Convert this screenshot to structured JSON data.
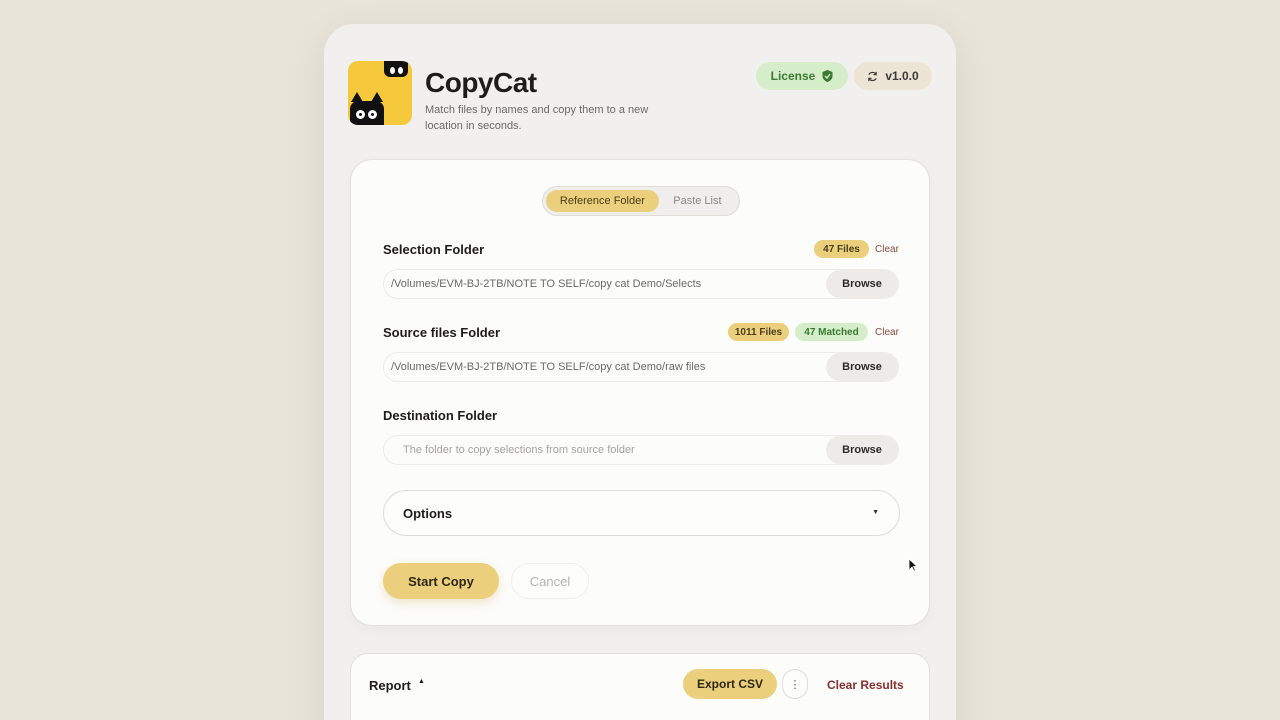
{
  "app": {
    "title": "CopyCat",
    "description": "Match files by names and copy them to a new location in seconds."
  },
  "header": {
    "license_label": "License",
    "version_label": "v1.0.0"
  },
  "mode_toggle": {
    "active": "Reference Folder",
    "inactive": "Paste List"
  },
  "selection": {
    "label": "Selection Folder",
    "files_badge": "47 Files",
    "clear_label": "Clear",
    "path": "/Volumes/EVM-BJ-2TB/NOTE TO SELF/copy cat Demo/Selects",
    "browse_label": "Browse"
  },
  "source": {
    "label": "Source files Folder",
    "files_badge": "1011 Files",
    "matched_badge": "47 Matched",
    "clear_label": "Clear",
    "path": "/Volumes/EVM-BJ-2TB/NOTE TO SELF/copy cat Demo/raw files",
    "browse_label": "Browse"
  },
  "destination": {
    "label": "Destination Folder",
    "placeholder": "The folder to copy selections from source folder",
    "browse_label": "Browse"
  },
  "options": {
    "label": "Options"
  },
  "actions": {
    "start_label": "Start Copy",
    "cancel_label": "Cancel"
  },
  "report": {
    "title": "Report",
    "export_label": "Export CSV",
    "more_label": "⋮",
    "clear_results_label": "Clear Results"
  },
  "colors": {
    "accent_yellow": "#ebcf7d",
    "success_green": "#d5eec9",
    "background": "#e8e4da"
  }
}
